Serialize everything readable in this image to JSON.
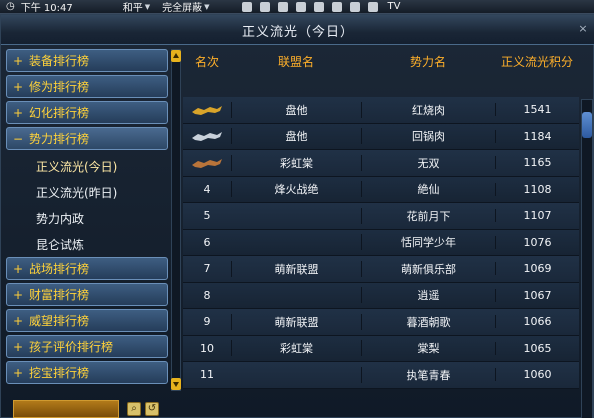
{
  "topbar": {
    "time": "下午 10:47",
    "server": "和平",
    "block_mode": "完全屏蔽",
    "tv": "TV"
  },
  "window": {
    "title": "正义流光（今日）",
    "close": "×"
  },
  "nav": {
    "categories_top": [
      {
        "sign": "+",
        "label": "装备排行榜"
      },
      {
        "sign": "+",
        "label": "修为排行榜"
      },
      {
        "sign": "+",
        "label": "幻化排行榜"
      },
      {
        "sign": "−",
        "label": "势力排行榜"
      }
    ],
    "subitems": [
      {
        "label": "正义流光(今日)",
        "active": true
      },
      {
        "label": "正义流光(昨日)",
        "active": false
      },
      {
        "label": "势力内政",
        "active": false
      },
      {
        "label": "昆仑试炼",
        "active": false
      }
    ],
    "categories_bottom": [
      {
        "sign": "+",
        "label": "战场排行榜"
      },
      {
        "sign": "+",
        "label": "财富排行榜"
      },
      {
        "sign": "+",
        "label": "威望排行榜"
      },
      {
        "sign": "+",
        "label": "孩子评价排行榜"
      },
      {
        "sign": "+",
        "label": "挖宝排行榜"
      }
    ]
  },
  "table": {
    "headers": {
      "rank": "名次",
      "alliance": "联盟名",
      "force": "势力名",
      "score": "正义流光积分"
    },
    "rows": [
      {
        "rank": "",
        "medal": "gold",
        "alliance": "盘他",
        "force": "红烧肉",
        "score": "1541"
      },
      {
        "rank": "",
        "medal": "silver",
        "alliance": "盘他",
        "force": "回锅肉",
        "score": "1184"
      },
      {
        "rank": "",
        "medal": "bronze",
        "alliance": "彩虹棠",
        "force": "无双",
        "score": "1165"
      },
      {
        "rank": "4",
        "alliance": "烽火战绝",
        "force": "絶仙",
        "score": "1108"
      },
      {
        "rank": "5",
        "alliance": "",
        "force": "花前月下",
        "score": "1107"
      },
      {
        "rank": "6",
        "alliance": "",
        "force": "恬同学少年",
        "score": "1076"
      },
      {
        "rank": "7",
        "alliance": "萌新联盟",
        "force": "萌新俱乐部",
        "score": "1069"
      },
      {
        "rank": "8",
        "alliance": "",
        "force": "逍遥",
        "score": "1067"
      },
      {
        "rank": "9",
        "alliance": "萌新联盟",
        "force": "暮酒朝歌",
        "score": "1066"
      },
      {
        "rank": "10",
        "alliance": "彩虹棠",
        "force": "棠梨",
        "score": "1065"
      },
      {
        "rank": "11",
        "alliance": "",
        "force": "执笔青春",
        "score": "1060"
      }
    ]
  },
  "colors": {
    "gold": "#d9a42a",
    "silver": "#c8d0da",
    "bronze": "#b9743a",
    "header": "#ffb02a",
    "category": "#ffd23a"
  }
}
